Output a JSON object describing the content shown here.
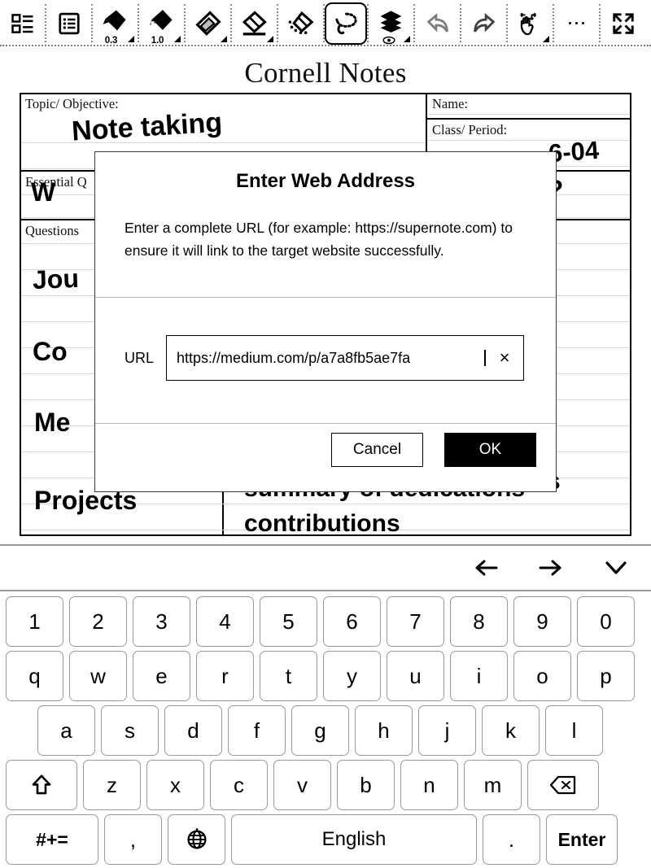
{
  "toolbar": {
    "buttons": [
      {
        "name": "page-list-icon",
        "label": "",
        "icon": "page-list",
        "selected": false
      },
      {
        "name": "note-list-icon",
        "label": "",
        "icon": "note-list",
        "selected": false
      },
      {
        "name": "pen-thin-icon",
        "label": "0.3",
        "icon": "pen",
        "selected": false
      },
      {
        "name": "pen-thick-icon",
        "label": "1.0",
        "icon": "marker",
        "selected": false
      },
      {
        "name": "highlighter-icon",
        "label": "",
        "icon": "highlighter",
        "selected": false
      },
      {
        "name": "eraser-icon",
        "label": "",
        "icon": "eraser",
        "selected": false
      },
      {
        "name": "eraser-area-icon",
        "label": "",
        "icon": "eraser-area",
        "selected": false
      },
      {
        "name": "lasso-select-icon",
        "label": "",
        "icon": "lasso",
        "selected": true
      },
      {
        "name": "layers-icon",
        "label": "",
        "icon": "layers",
        "selected": false
      },
      {
        "name": "undo-icon",
        "label": "",
        "icon": "undo",
        "selected": false
      },
      {
        "name": "redo-icon",
        "label": "",
        "icon": "redo",
        "selected": false
      },
      {
        "name": "pan-hand-icon",
        "label": "",
        "icon": "pan",
        "selected": false
      },
      {
        "name": "more-options-icon",
        "label": "",
        "icon": "more",
        "selected": false
      },
      {
        "name": "fullscreen-icon",
        "label": "",
        "icon": "fullscreen",
        "selected": false
      }
    ]
  },
  "note": {
    "title": "Cornell Notes",
    "labels": {
      "topic": "Topic/ Objective:",
      "name": "Name:",
      "class_period": "Class/ Period:",
      "essential_question": "Essential Q",
      "questions": "Questions"
    },
    "handwriting": {
      "topic_value": "Note taking",
      "date_value": "6-04",
      "essential_value": "W",
      "essential_tail": "s ?",
      "q1": "Jou",
      "q2": "Co",
      "q3": "Me",
      "q4": "Projects",
      "note1": "summary of dedications",
      "note2": "contributions",
      "note_tail": "s"
    }
  },
  "dialog": {
    "title": "Enter Web Address",
    "message": "Enter a complete URL (for example: https://supernote.com) to ensure it will link to the target website successfully.",
    "url_label": "URL",
    "url_value": "https://medium.com/p/a7a8fb5ae7fa",
    "url_placeholder": "https://",
    "clear_icon": "×",
    "cancel_label": "Cancel",
    "ok_label": "OK"
  },
  "navbar": {
    "back_icon": "←",
    "forward_icon": "→",
    "collapse_icon": "∨"
  },
  "keyboard": {
    "row1": [
      "1",
      "2",
      "3",
      "4",
      "5",
      "6",
      "7",
      "8",
      "9",
      "0"
    ],
    "row2": [
      "q",
      "w",
      "e",
      "r",
      "t",
      "y",
      "u",
      "i",
      "o",
      "p"
    ],
    "row3": [
      "a",
      "s",
      "d",
      "f",
      "g",
      "h",
      "j",
      "k",
      "l"
    ],
    "row4": {
      "shift": "⇧",
      "keys": [
        "z",
        "x",
        "c",
        "v",
        "b",
        "n",
        "m"
      ],
      "backspace": "⌫"
    },
    "row5": {
      "symbols": "#+=",
      "comma": ",",
      "globe": "⊕",
      "space": "English",
      "period": ".",
      "enter": "Enter"
    }
  },
  "colors": {
    "accent": "#000000",
    "key_border": "#999999",
    "rule_line": "#d8d8d8",
    "divider": "#b9b9b9"
  }
}
